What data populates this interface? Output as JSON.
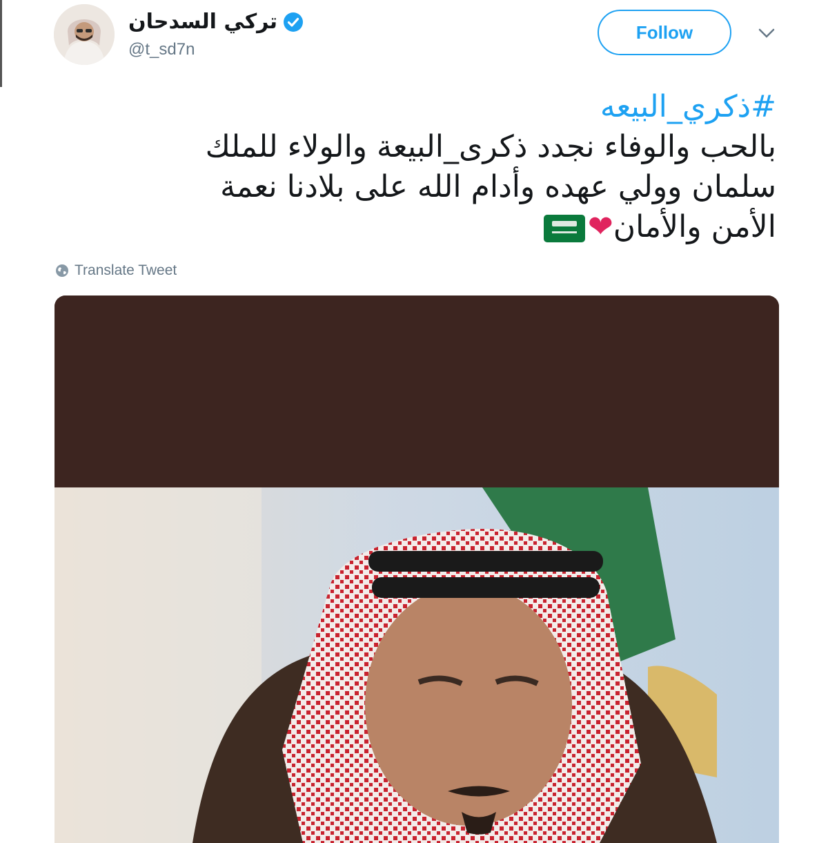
{
  "tweet": {
    "author": {
      "display_name": "تركي السدحان",
      "handle": "@t_sd7n",
      "verified": true,
      "avatar_icon": "avatar-photo"
    },
    "follow_label": "Follow",
    "hashtag": "#ذكري_البيعه",
    "body_lines": [
      "بالحب والوفاء نجدد ذكرى_البيعة والولاء للملك",
      "سلمان وولي عهده وأدام الله على بلادنا نعمة",
      "الأمن والأمان"
    ],
    "emoji": [
      "heart",
      "saudi-flag"
    ],
    "translate_label": "Translate Tweet",
    "media": {
      "type": "photo",
      "description_icon": "portrait-photo"
    }
  },
  "colors": {
    "accent": "#1da1f2",
    "text": "#14171a",
    "muted": "#657786",
    "heart": "#e0245e",
    "flag_green": "#0a7a3c",
    "media_band": "#3d2520"
  }
}
